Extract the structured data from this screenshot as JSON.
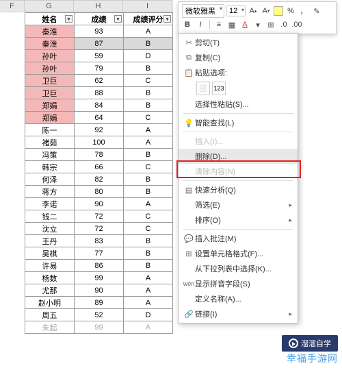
{
  "columns": {
    "F": "F",
    "G": "G",
    "H": "H",
    "I": "I"
  },
  "headers": {
    "name": "姓名",
    "score": "成绩",
    "grade": "成绩评分"
  },
  "rows": [
    {
      "n": "秦淮",
      "s": "93",
      "g": "A",
      "pink": true
    },
    {
      "n": "秦淮",
      "s": "87",
      "g": "B",
      "pink": true,
      "sel": true
    },
    {
      "n": "孙叶",
      "s": "59",
      "g": "D",
      "pink": true
    },
    {
      "n": "孙叶",
      "s": "79",
      "g": "B",
      "pink": true
    },
    {
      "n": "卫巨",
      "s": "62",
      "g": "C",
      "pink": true
    },
    {
      "n": "卫巨",
      "s": "88",
      "g": "B",
      "pink": true
    },
    {
      "n": "郑娟",
      "s": "84",
      "g": "B",
      "pink": true
    },
    {
      "n": "郑娟",
      "s": "64",
      "g": "C",
      "pink": true
    },
    {
      "n": "陈一",
      "s": "92",
      "g": "A"
    },
    {
      "n": "褚茹",
      "s": "100",
      "g": "A"
    },
    {
      "n": "冯策",
      "s": "78",
      "g": "B"
    },
    {
      "n": "韩宗",
      "s": "66",
      "g": "C"
    },
    {
      "n": "何泽",
      "s": "82",
      "g": "B"
    },
    {
      "n": "蒋方",
      "s": "80",
      "g": "B"
    },
    {
      "n": "李诺",
      "s": "90",
      "g": "A"
    },
    {
      "n": "钱二",
      "s": "72",
      "g": "C"
    },
    {
      "n": "沈立",
      "s": "72",
      "g": "C"
    },
    {
      "n": "王丹",
      "s": "83",
      "g": "B"
    },
    {
      "n": "吴棋",
      "s": "77",
      "g": "B"
    },
    {
      "n": "许易",
      "s": "86",
      "g": "B"
    },
    {
      "n": "杨数",
      "s": "99",
      "g": "A"
    },
    {
      "n": "尤那",
      "s": "90",
      "g": "A"
    },
    {
      "n": "赵小明",
      "s": "89",
      "g": "A"
    },
    {
      "n": "周五",
      "s": "52",
      "g": "D"
    },
    {
      "n": "朱起",
      "s": "99",
      "g": "A",
      "grey": true
    }
  ],
  "toolbar": {
    "font": "微软雅黑",
    "size": "12",
    "boldA": "A",
    "smallA": "A",
    "pct": "%"
  },
  "menu": {
    "cut": "剪切(T)",
    "copy": "复制(C)",
    "pasteOpt": "粘贴选项:",
    "pasteSpecial": "选择性粘贴(S)...",
    "smartLookup": "智能查找(L)",
    "insert": "插入(I)...",
    "delete": "删除(D)...",
    "clear": "清除内容(N)",
    "quick": "快速分析(Q)",
    "filter": "筛选(E)",
    "sort": "排序(O)",
    "comment": "插入批注(M)",
    "format": "设置单元格格式(F)...",
    "dropdown": "从下拉列表中选择(K)...",
    "pinyin": "显示拼音字段(S)",
    "define": "定义名称(A)...",
    "link": "链接(I)"
  },
  "logo": "溜溜自学",
  "watermark": "幸福手游网"
}
